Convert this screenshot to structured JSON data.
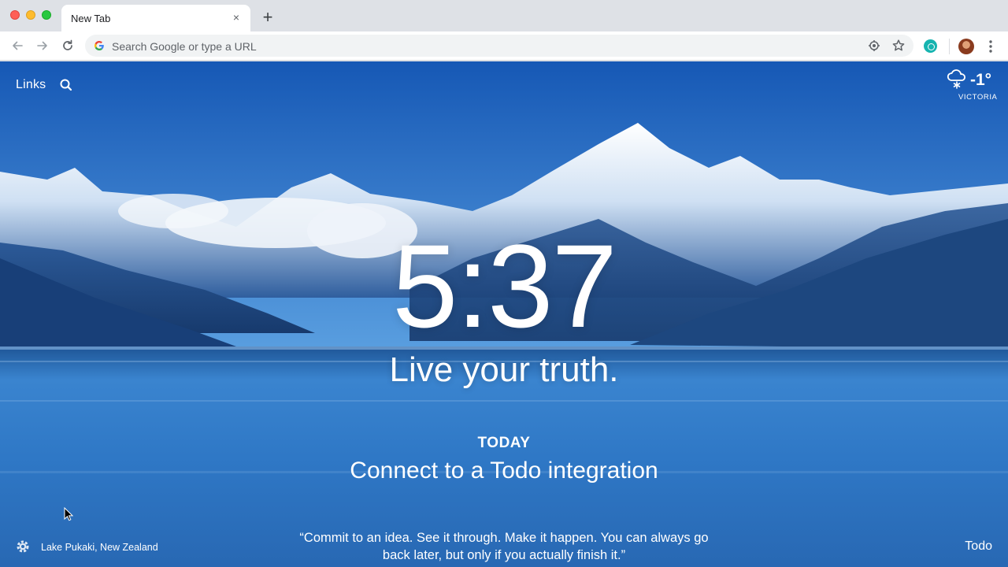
{
  "browser": {
    "tab_title": "New Tab",
    "tab_close": "×",
    "new_tab": "+",
    "omnibox_placeholder": "Search Google or type a URL"
  },
  "icons": {
    "back": "back-arrow-icon",
    "forward": "forward-arrow-icon",
    "reload": "reload-icon",
    "google": "google-g-icon",
    "location": "location-target-icon",
    "bookmark": "star-icon",
    "extension": "momentum-extension-icon",
    "profile": "avatar",
    "menu": "kebab-menu-icon",
    "links_search": "search-icon",
    "weather": "snow-cloud-icon",
    "settings": "gear-icon"
  },
  "topbar": {
    "links_label": "Links"
  },
  "weather": {
    "temperature": "-1°",
    "location": "VICTORIA"
  },
  "center": {
    "time": "5:37",
    "mantra": "Live your truth.",
    "today_label": "TODAY",
    "todo_prompt": "Connect to a Todo integration"
  },
  "footer": {
    "photo_location": "Lake Pukaki, New Zealand",
    "quote": "“Commit to an idea. See it through. Make it happen. You can always go back later, but only if you actually finish it.”",
    "todo_label": "Todo"
  },
  "colors": {
    "sky": "#1b5fb8",
    "snow": "#f3f7fc",
    "lake": "#2c74c2",
    "chrome_bg": "#dee1e6"
  }
}
